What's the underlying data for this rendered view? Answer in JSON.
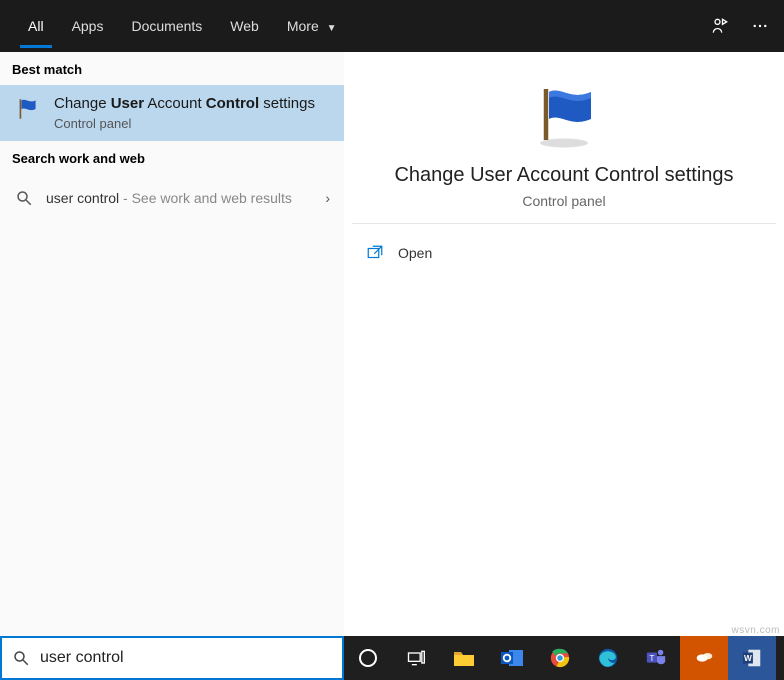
{
  "topbar": {
    "tabs": [
      {
        "label": "All",
        "active": true
      },
      {
        "label": "Apps"
      },
      {
        "label": "Documents"
      },
      {
        "label": "Web"
      },
      {
        "label": "More",
        "dropdown": true
      }
    ]
  },
  "left": {
    "best_match_header": "Best match",
    "best_match": {
      "title_pre": "Change ",
      "title_b1": "User",
      "title_mid": " Account ",
      "title_b2": "Control",
      "title_post": " settings",
      "sub": "Control panel"
    },
    "work_web_header": "Search work and web",
    "web_item": {
      "query": "user control",
      "suffix": " - See work and web results"
    }
  },
  "preview": {
    "title": "Change User Account Control settings",
    "sub": "Control panel",
    "open_label": "Open"
  },
  "search": {
    "value": "user control"
  },
  "watermark": "wsvn.com"
}
